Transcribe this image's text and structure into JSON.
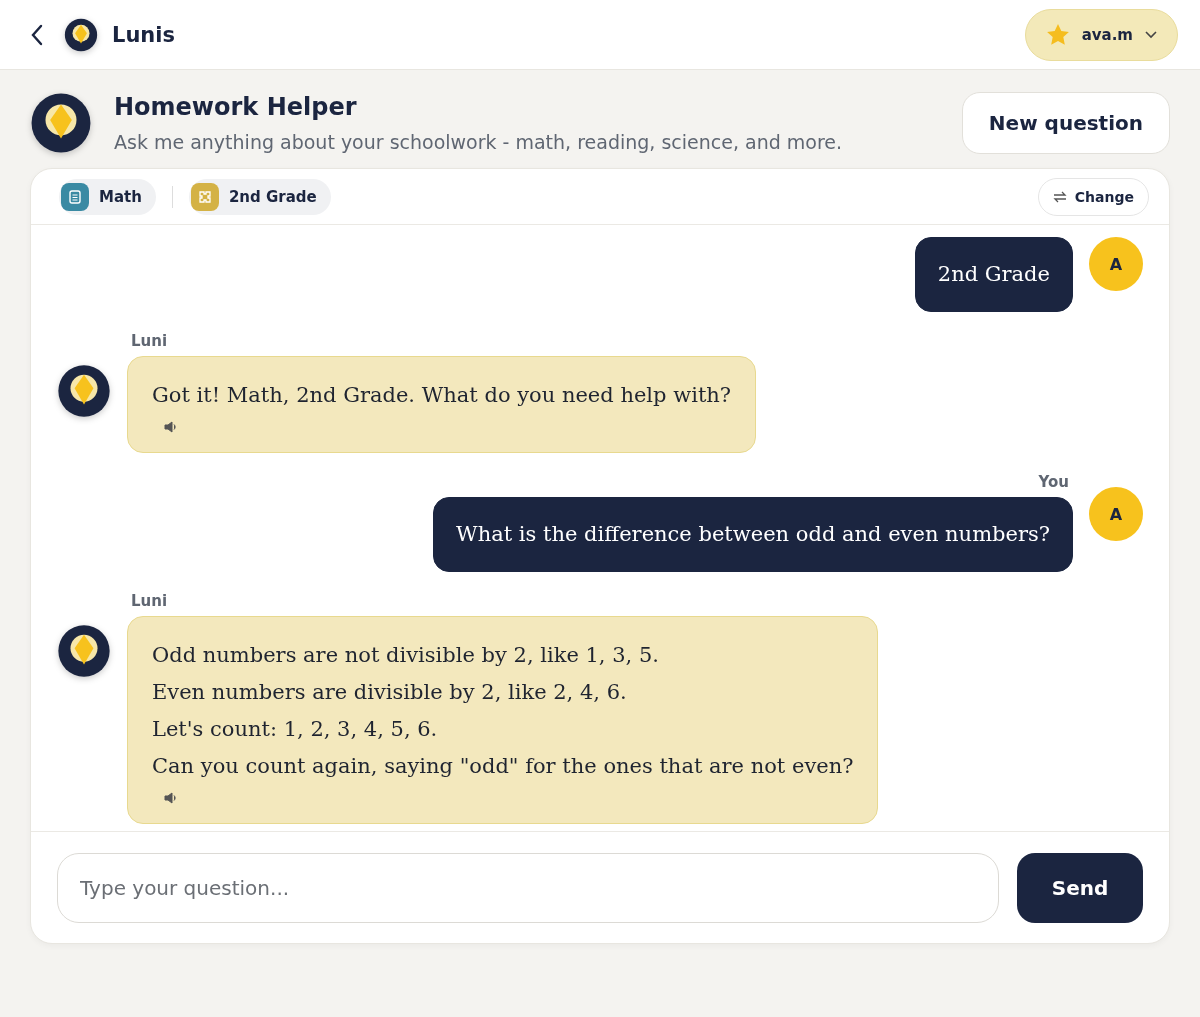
{
  "topbar": {
    "brand": "Lunis",
    "user": {
      "name": "ava.m"
    }
  },
  "header": {
    "title": "Homework Helper",
    "subtitle": "Ask me anything about your schoolwork - math, reading, science, and more.",
    "button": "New question"
  },
  "context": {
    "chips": [
      {
        "label": "Math",
        "kind": "subject",
        "color": "#3a8aa3"
      },
      {
        "label": "2nd Grade",
        "kind": "grade",
        "color": "#d4b245"
      }
    ],
    "change": "Change"
  },
  "messages": [
    {
      "kind": "user",
      "lines": [
        "2nd Grade"
      ],
      "avatar": "A"
    },
    {
      "kind": "assistant",
      "sender": "Luni",
      "lines": [
        "Got it! Math, 2nd Grade. What do you need help with?"
      ]
    },
    {
      "kind": "user",
      "sender": "You",
      "lines": [
        "What is the difference between odd and even numbers?"
      ],
      "avatar": "A"
    },
    {
      "kind": "assistant",
      "sender": "Luni",
      "lines": [
        "Odd numbers are not divisible by 2, like 1, 3, 5.",
        "Even numbers are divisible by 2, like 2, 4, 6.",
        "Let's count: 1, 2, 3, 4, 5, 6.",
        "Can you count again, saying \"odd\" for the ones that are not even?"
      ]
    }
  ],
  "composer": {
    "placeholder": "Type your question...",
    "button": "Send"
  }
}
